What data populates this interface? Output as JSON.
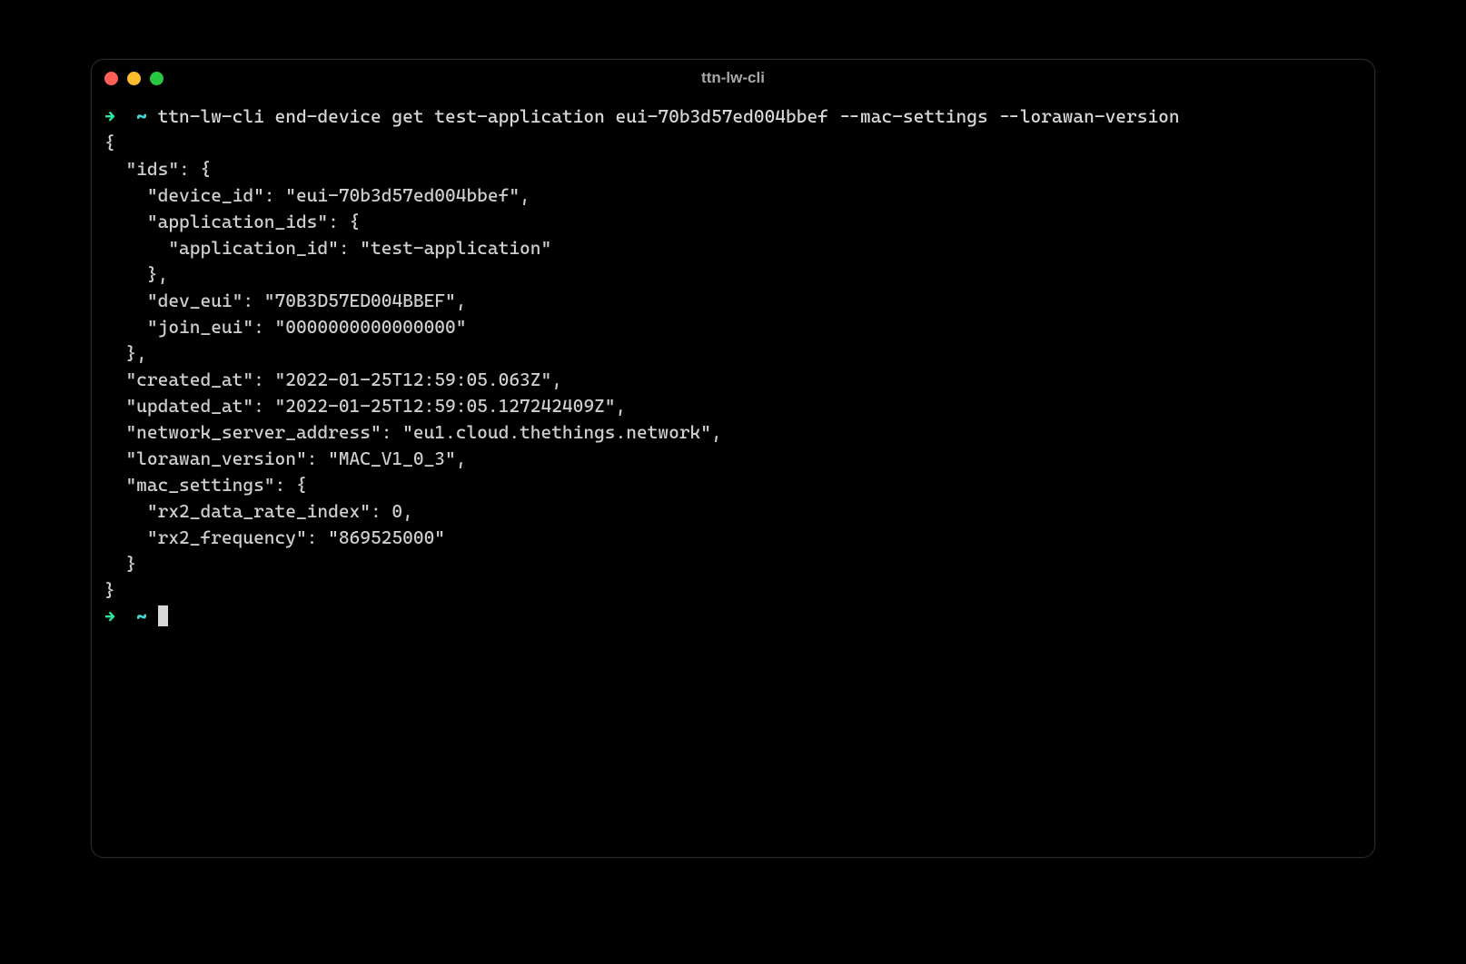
{
  "window": {
    "title": "ttn-lw-cli"
  },
  "prompt": {
    "arrow": "→",
    "tilde": "~"
  },
  "command": "ttn-lw-cli end-device get test-application eui-70b3d57ed004bbef --mac-settings --lorawan-version",
  "output_lines": [
    "{",
    "  \"ids\": {",
    "    \"device_id\": \"eui-70b3d57ed004bbef\",",
    "    \"application_ids\": {",
    "      \"application_id\": \"test-application\"",
    "    },",
    "    \"dev_eui\": \"70B3D57ED004BBEF\",",
    "    \"join_eui\": \"0000000000000000\"",
    "  },",
    "  \"created_at\": \"2022-01-25T12:59:05.063Z\",",
    "  \"updated_at\": \"2022-01-25T12:59:05.127242409Z\",",
    "  \"network_server_address\": \"eu1.cloud.thethings.network\",",
    "  \"lorawan_version\": \"MAC_V1_0_3\",",
    "  \"mac_settings\": {",
    "    \"rx2_data_rate_index\": 0,",
    "    \"rx2_frequency\": \"869525000\"",
    "  }",
    "}"
  ]
}
